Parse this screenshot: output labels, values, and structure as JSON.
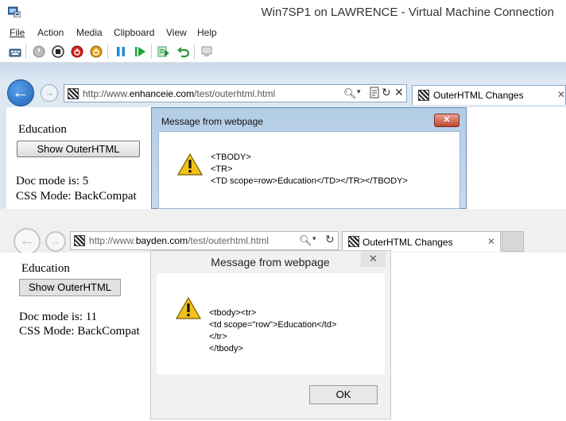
{
  "window": {
    "title": "Win7SP1 on LAWRENCE - Virtual Machine Connection",
    "menu": [
      "File",
      "Action",
      "Media",
      "Clipboard",
      "View",
      "Help"
    ],
    "toolbar_icons": [
      "ctrl-alt-del-icon",
      "start-icon",
      "turn-off-icon",
      "shut-down-icon",
      "save-icon",
      "pause-icon",
      "reset-icon",
      "snapshot-icon",
      "revert-icon",
      "enhanced-session-icon"
    ]
  },
  "browser1": {
    "url_prefix": "http://www.",
    "url_domain": "enhanceie.com",
    "url_path": "/test/outerhtml.html",
    "tab_title": "OuterHTML Changes",
    "page": {
      "heading": "Education",
      "button": "Show OuterHTML",
      "doc_mode": "Doc mode is: 5",
      "css_mode": "CSS Mode: BackCompat"
    },
    "dialog": {
      "title": "Message from webpage",
      "lines": [
        "<TBODY>",
        "<TR>",
        "<TD scope=row>Education</TD></TR></TBODY>"
      ]
    }
  },
  "browser2": {
    "url_prefix": "http://www.",
    "url_domain": "bayden.com",
    "url_path": "/test/outerhtml.html",
    "tab_title": "OuterHTML Changes",
    "page": {
      "heading": "Education",
      "button": "Show OuterHTML",
      "doc_mode": "Doc mode is: 11",
      "css_mode": "CSS Mode: BackCompat"
    },
    "dialog": {
      "title": "Message from webpage",
      "lines": [
        "<tbody><tr>",
        "<td scope=\"row\">Education</td>",
        "</tr>",
        "</tbody>"
      ],
      "ok": "OK"
    }
  },
  "colors": {
    "win7_dialog_chrome": "#b3cde6",
    "win7_close": "#c0452f",
    "back_button": "#1e63b8",
    "win8_chrome": "#f0f0f0"
  }
}
